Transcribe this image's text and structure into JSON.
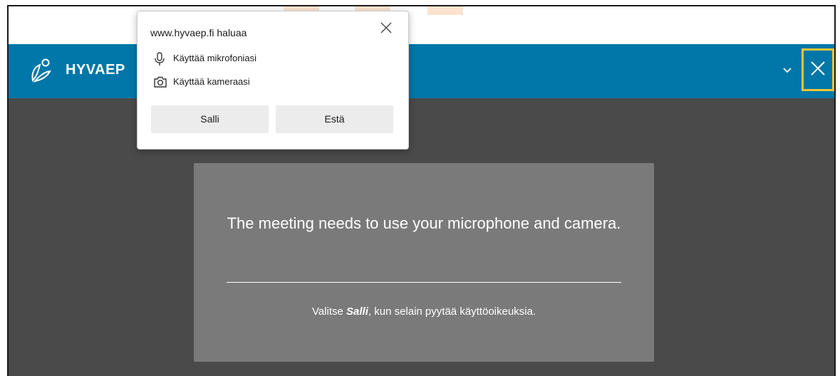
{
  "app": {
    "brand": "HYVAEP"
  },
  "permission_popup": {
    "title": "www.hyvaep.fi haluaa",
    "permissions": [
      {
        "icon": "microphone-icon",
        "label": "Käyttää mikrofoniasi"
      },
      {
        "icon": "camera-icon",
        "label": "Käyttää kameraasi"
      }
    ],
    "allow_label": "Salli",
    "block_label": "Estä"
  },
  "message_card": {
    "title": "The meeting needs to use your microphone and camera.",
    "note_before": "Valitse ",
    "note_emphasis": "Salli",
    "note_after": ", kun selain pyytää käyttöoikeuksia."
  },
  "colors": {
    "app_bar": "#0077a8",
    "main_bg": "#4a4a4a",
    "card_bg": "#7a7a7a",
    "highlight": "#f1c634"
  }
}
